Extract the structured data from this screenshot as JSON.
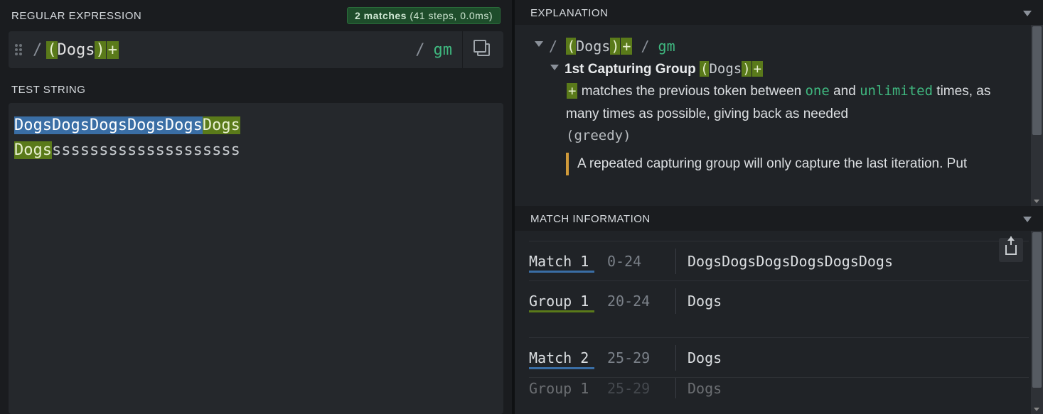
{
  "left": {
    "regex_header": "REGULAR EXPRESSION",
    "match_badge_bold": "2 matches",
    "match_badge_rest": " (41 steps, 0.0ms)",
    "regex_open_paren": "(",
    "regex_literal": "Dogs",
    "regex_close_paren": ")",
    "regex_quant": "+",
    "flags": "gm",
    "test_header": "TEST STRING",
    "test_line1_match": "DogsDogsDogsDogsDogs",
    "test_line1_group": "Dogs",
    "test_line2_match": "Dogs",
    "test_line2_rest": "ssssssssssssssssssss"
  },
  "explanation": {
    "header": "EXPLANATION",
    "regex_slash1": "/ ",
    "regex_paren_open": "(",
    "regex_literal": "Dogs",
    "regex_paren_close": ")",
    "regex_quant": "+",
    "regex_slash2": " / ",
    "regex_flags": "gm",
    "group_title": "1st Capturing Group ",
    "group_regex_open": "(",
    "group_regex_lit": "Dogs",
    "group_regex_close": ")",
    "group_regex_quant": "+",
    "desc_quant": "+",
    "desc_1": " matches the previous token between ",
    "desc_one": "one",
    "desc_and": " and ",
    "desc_unl": "unlimited",
    "desc_2": " times, as many times as possible, giving back as needed ",
    "desc_greedy": "(greedy)",
    "note": "A repeated capturing group will only capture the last iteration. Put"
  },
  "matchinfo": {
    "header": "MATCH INFORMATION",
    "rows": [
      {
        "label": "Match 1",
        "range": "0-24",
        "value": "DogsDogsDogsDogsDogsDogs",
        "underline": "blue"
      },
      {
        "label": "Group 1",
        "range": "20-24",
        "value": "Dogs",
        "underline": "green"
      },
      {
        "label": "Match 2",
        "range": "25-29",
        "value": "Dogs",
        "underline": "blue"
      }
    ],
    "cut": {
      "label": "Group 1",
      "range": "25-29",
      "value": "Dogs"
    }
  }
}
